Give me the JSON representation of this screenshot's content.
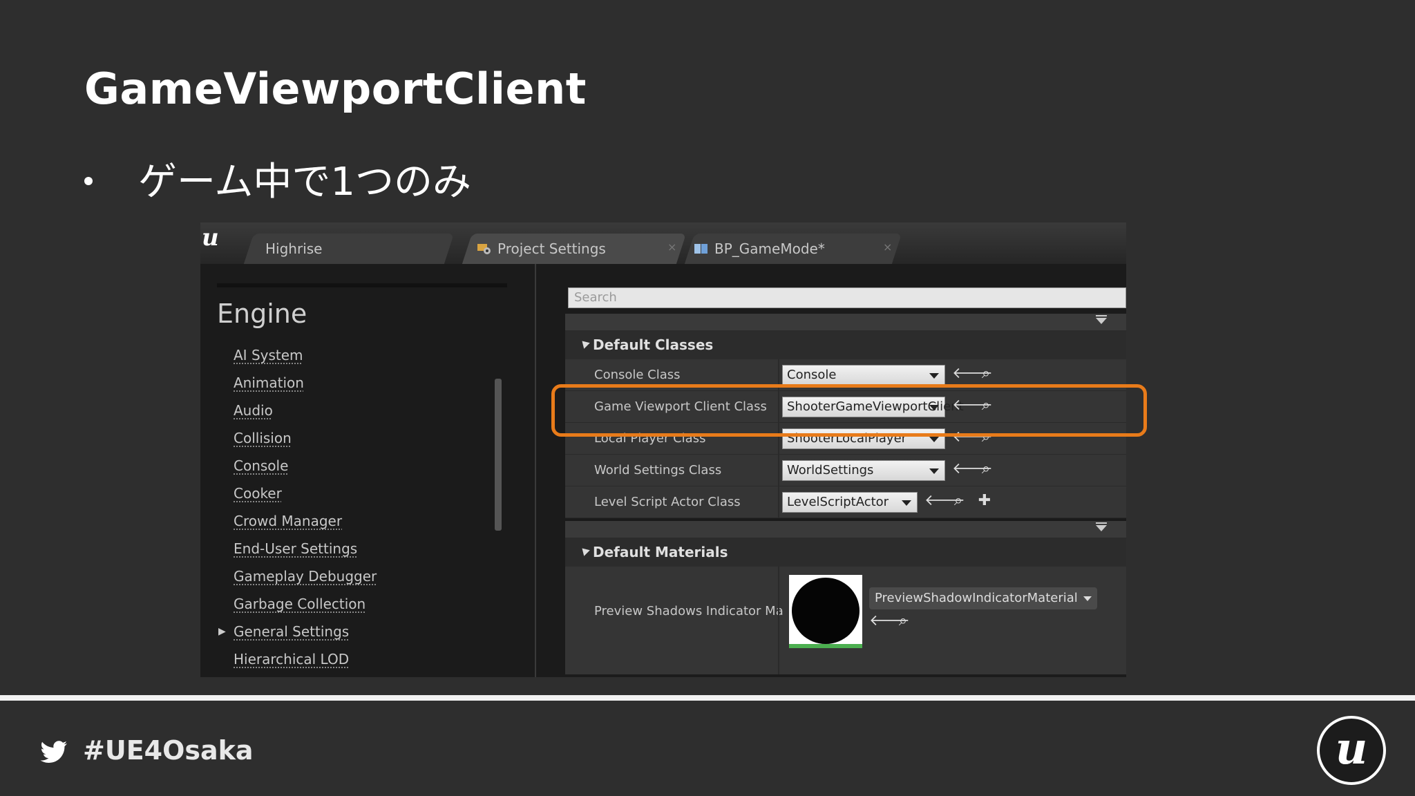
{
  "slide": {
    "title": "GameViewportClient",
    "bullet": "ゲーム中で1つのみ"
  },
  "editor": {
    "logo_icon": "unreal-logo-icon",
    "tabs": [
      {
        "label": "Highrise",
        "icon": "",
        "active": false,
        "close": ""
      },
      {
        "label": "Project Settings",
        "icon": "settings-gear-icon",
        "active": true,
        "close": "×"
      },
      {
        "label": "BP_GameMode*",
        "icon": "blueprint-book-icon",
        "active": false,
        "close": "×"
      }
    ],
    "sidebar": {
      "heading": "Engine",
      "items": [
        "AI System",
        "Animation",
        "Audio",
        "Collision",
        "Console",
        "Cooker",
        "Crowd Manager",
        "End-User Settings",
        "Gameplay Debugger",
        "Garbage Collection",
        "General Settings",
        "Hierarchical LOD"
      ]
    },
    "search": {
      "placeholder": "Search"
    },
    "default_classes": {
      "header": "Default Classes",
      "rows": [
        {
          "label": "Console Class",
          "value": "Console"
        },
        {
          "label": "Game Viewport Client Class",
          "value": "ShooterGameViewportClient"
        },
        {
          "label": "Local Player Class",
          "value": "ShooterLocalPlayer"
        },
        {
          "label": "World Settings Class",
          "value": "WorldSettings"
        },
        {
          "label": "Level Script Actor Class",
          "value": "LevelScriptActor"
        }
      ]
    },
    "default_materials": {
      "header": "Default Materials",
      "row_label": "Preview Shadows Indicator Ma",
      "value": "PreviewShadowIndicatorMaterial"
    },
    "highlight_color": "#e87b1a"
  },
  "footer": {
    "hashtag": "#UE4Osaka",
    "twitter_icon": "twitter-bird-icon",
    "logo_icon": "unreal-engine-logo-icon"
  }
}
